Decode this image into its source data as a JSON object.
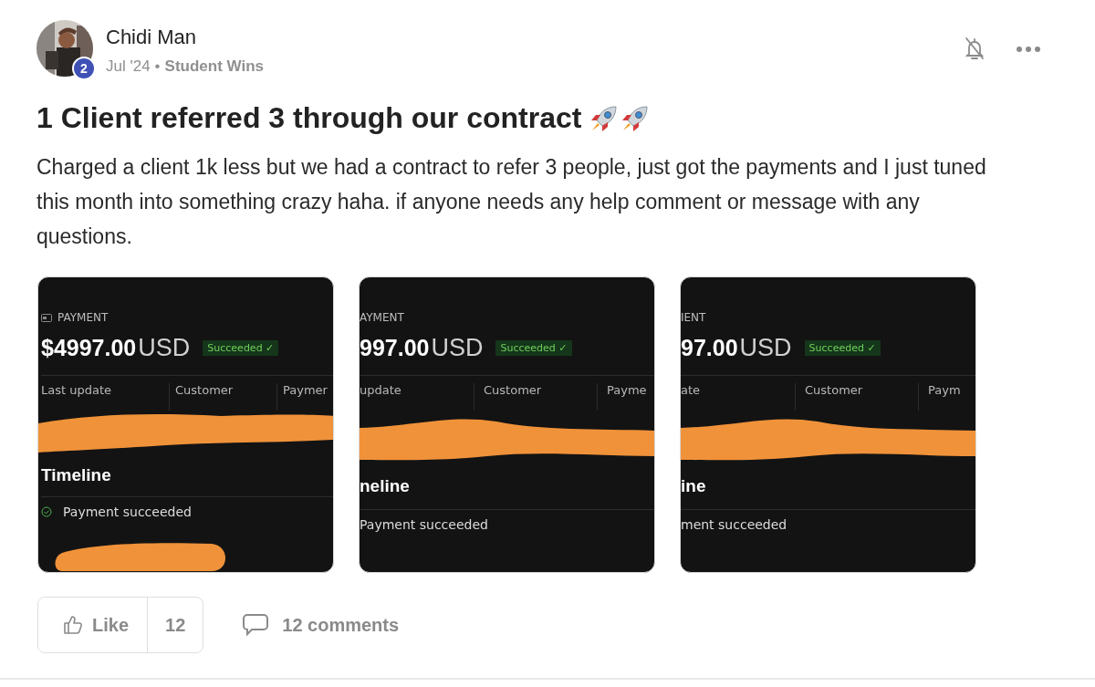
{
  "post": {
    "author": {
      "name": "Chidi Man",
      "badge": "2"
    },
    "date": "Jul '24",
    "separator": "•",
    "category": "Student Wins",
    "title": "1 Client referred 3 through our contract",
    "body": "Charged a client 1k less but we had a contract to refer 3 people, just got the payments and I just tuned this month into something crazy haha. if anyone needs any help comment or message with any questions.",
    "attachments": [
      {
        "kind": "full",
        "section_label": "PAYMENT",
        "amount": "$4997.00",
        "currency": "USD",
        "status": "Succeeded ✓",
        "columns": [
          "Last update",
          "Customer",
          "Paymer"
        ],
        "heading": "Timeline",
        "event": "Payment succeeded"
      },
      {
        "kind": "cropped",
        "section_label": "AYMENT",
        "amount": "997.00",
        "currency": "USD",
        "status": "Succeeded ✓",
        "columns": [
          "update",
          "Customer",
          "Payme"
        ],
        "heading": "neline",
        "event": "Payment succeeded"
      },
      {
        "kind": "cropped",
        "section_label": "IENT",
        "amount": "97.00",
        "currency": "USD",
        "status": "Succeeded ✓",
        "columns": [
          "ate",
          "Customer",
          "Paym"
        ],
        "heading": "ine",
        "event": "ment succeeded"
      }
    ],
    "like": {
      "label": "Like",
      "count": "12"
    },
    "comments": "12 comments"
  }
}
